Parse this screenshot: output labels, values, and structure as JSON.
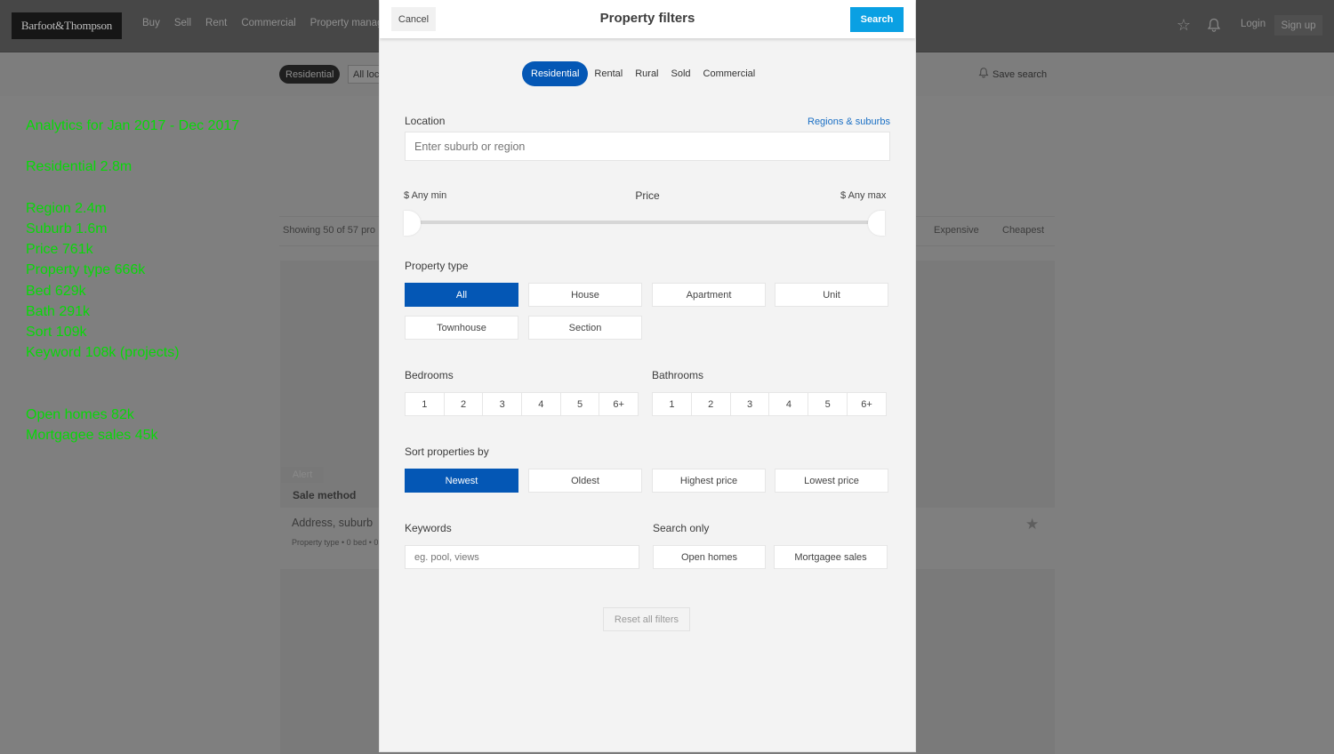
{
  "background": {
    "logo": "Barfoot&Thompson",
    "nav": [
      "Buy",
      "Sell",
      "Rent",
      "Commercial",
      "Property manage"
    ],
    "login": "Login",
    "signup": "Sign up",
    "category_pill": "Residential",
    "location_select": "All loc",
    "save_search": "Save search",
    "showing": "Showing 50 of 57 pro",
    "sort_options": [
      "Expensive",
      "Cheapest"
    ],
    "listing": {
      "alert_tag": "Alert",
      "sale_method": "Sale method",
      "address": "Address, suburb",
      "meta": "Property type • 0 bed • 0"
    }
  },
  "analytics": {
    "title": "Analytics for Jan 2017 - Dec 2017",
    "residential": "Residential 2.8m",
    "breakdown": [
      "Region 2.4m",
      "Suburb 1.6m",
      "Price 761k",
      "Property type 666k",
      "Bed 629k",
      "Bath 291k",
      "Sort 109k",
      "Keyword 108k (projects)"
    ],
    "extras": [
      "Open homes 82k",
      "Mortgagee sales 45k"
    ],
    "color": "#08d808"
  },
  "modal": {
    "title": "Property filters",
    "cancel": "Cancel",
    "search": "Search",
    "categories": [
      {
        "label": "Residential",
        "active": true
      },
      {
        "label": "Rental",
        "active": false
      },
      {
        "label": "Rural",
        "active": false
      },
      {
        "label": "Sold",
        "active": false
      },
      {
        "label": "Commercial",
        "active": false
      }
    ],
    "location": {
      "label": "Location",
      "link": "Regions & suburbs",
      "placeholder": "Enter suburb or region",
      "value": ""
    },
    "price": {
      "label": "Price",
      "min_label": "$ Any min",
      "max_label": "$ Any max",
      "range_fraction": [
        0,
        1
      ]
    },
    "property_type": {
      "label": "Property type",
      "options": [
        "All",
        "House",
        "Apartment",
        "Unit",
        "Townhouse",
        "Section"
      ],
      "selected": "All"
    },
    "bedrooms": {
      "label": "Bedrooms",
      "options": [
        "1",
        "2",
        "3",
        "4",
        "5",
        "6+"
      ]
    },
    "bathrooms": {
      "label": "Bathrooms",
      "options": [
        "1",
        "2",
        "3",
        "4",
        "5",
        "6+"
      ]
    },
    "sort": {
      "label": "Sort properties by",
      "options": [
        "Newest",
        "Oldest",
        "Highest price",
        "Lowest price"
      ],
      "selected": "Newest"
    },
    "keywords": {
      "label": "Keywords",
      "placeholder": "eg. pool, views",
      "value": ""
    },
    "search_only": {
      "label": "Search only",
      "options": [
        "Open homes",
        "Mortgagee sales"
      ]
    },
    "reset": "Reset all filters",
    "accent_color": "#0457b5",
    "search_button_color": "#0aa0e3"
  }
}
